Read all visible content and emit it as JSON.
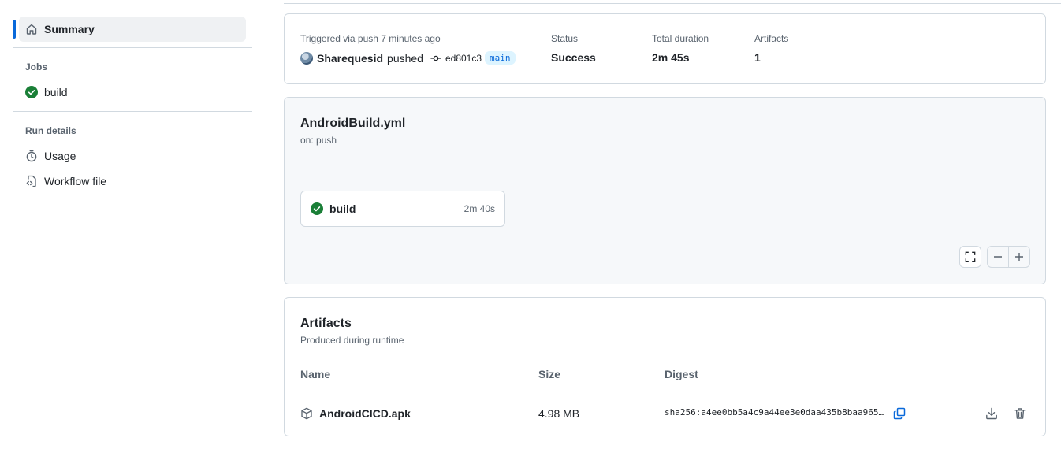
{
  "sidebar": {
    "summary_label": "Summary",
    "jobs_heading": "Jobs",
    "jobs": [
      {
        "label": "build",
        "status": "success"
      }
    ],
    "run_details_heading": "Run details",
    "run_details": [
      {
        "label": "Usage",
        "icon": "stopwatch-icon"
      },
      {
        "label": "Workflow file",
        "icon": "file-code-icon"
      }
    ]
  },
  "summary": {
    "trigger_text": "Triggered via push 7 minutes ago",
    "actor": "Sharequesid",
    "action": "pushed",
    "commit_sha": "ed801c3",
    "branch": "main",
    "status_label": "Status",
    "status_value": "Success",
    "duration_label": "Total duration",
    "duration_value": "2m 45s",
    "artifacts_label": "Artifacts",
    "artifacts_value": "1"
  },
  "graph": {
    "workflow_file": "AndroidBuild.yml",
    "trigger": "on: push",
    "job": {
      "name": "build",
      "duration": "2m 40s"
    }
  },
  "artifacts": {
    "title": "Artifacts",
    "subtitle": "Produced during runtime",
    "columns": {
      "name": "Name",
      "size": "Size",
      "digest": "Digest"
    },
    "rows": [
      {
        "name": "AndroidCICD.apk",
        "size": "4.98 MB",
        "digest": "sha256:a4ee0bb5a4c9a44ee3e0daa435b8baa965…"
      }
    ]
  },
  "colors": {
    "accent": "#0969da",
    "success": "#1a7f37",
    "border": "#d1d9e0",
    "muted": "#59636e"
  }
}
